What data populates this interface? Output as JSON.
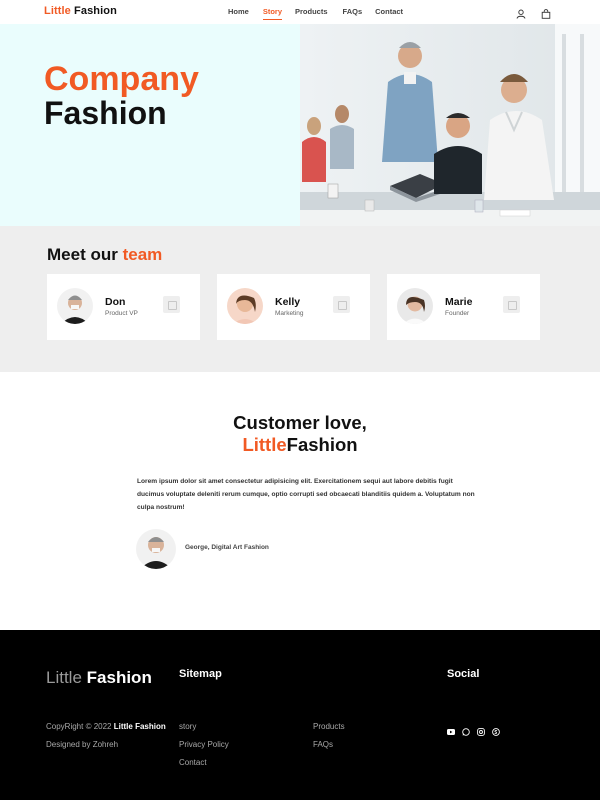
{
  "nav": {
    "brand_accent": "Little",
    "brand_rest": "Fashion",
    "links": [
      "Home",
      "Story",
      "Products",
      "FAQs",
      "Contact"
    ],
    "active": "Story",
    "icons": [
      "user-icon",
      "shopping-bag-icon"
    ]
  },
  "hero": {
    "title_accent": "Company",
    "title_rest": "Fashion"
  },
  "team": {
    "heading": "Meet our",
    "heading_accent": "team",
    "members": [
      {
        "name": "Don",
        "role": "Product VP"
      },
      {
        "name": "Kelly",
        "role": "Marketing"
      },
      {
        "name": "Marie",
        "role": "Founder"
      }
    ]
  },
  "testimonial": {
    "title_line1": "Customer love,",
    "title_accent": "Little",
    "title_rest": "Fashion",
    "quote": "Lorem ipsum dolor sit amet consectetur adipisicing elit. Exercitationem sequi aut labore debitis fugit ducimus voluptate deleniti rerum cumque, optio corrupti sed obcaecati blanditiis quidem a. Voluptatum non culpa nostrum!",
    "author": "George, Digital Art Fashion"
  },
  "footer": {
    "brand_light": "Little",
    "brand_bold": "Fashion",
    "copyright_prefix": "CopyRight © 2022",
    "copyright_brand": "Little Fashion",
    "designed_by": "Designed by Zohreh",
    "sitemap_heading": "Sitemap",
    "sitemap_col1": [
      "story",
      "Privacy Policy",
      "Contact"
    ],
    "sitemap_col2": [
      "Products",
      "FAQs"
    ],
    "social_heading": "Social",
    "social_icons": [
      "youtube-icon",
      "whatsapp-icon",
      "instagram-icon",
      "skype-icon"
    ]
  },
  "colors": {
    "accent": "#f15a24",
    "hero_bg": "#eafdfd",
    "team_bg": "#eeeeee",
    "footer_bg": "#000000"
  }
}
